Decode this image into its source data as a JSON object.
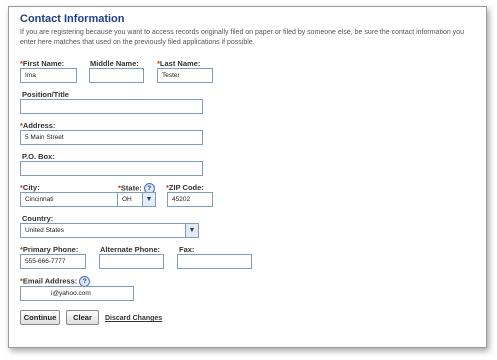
{
  "section": {
    "title": "Contact Information",
    "description": "If you are registering because you want to access records originally filed on paper or filed by someone else, be sure the contact information you enter here matches that used on the previously filed applications if possible."
  },
  "required_marker": "*",
  "help_icon_glyph": "?",
  "fields": {
    "first_name": {
      "label": "First Name:",
      "value": "Ima"
    },
    "middle_name": {
      "label": "Middle Name:",
      "value": ""
    },
    "last_name": {
      "label": "Last Name:",
      "value": "Tester"
    },
    "position_title": {
      "label": "Position/Title",
      "value": ""
    },
    "address": {
      "label": "Address:",
      "value": "5 Main Street"
    },
    "po_box": {
      "label": "P.O. Box:",
      "value": ""
    },
    "city": {
      "label": "City:",
      "value": "Cincinnati"
    },
    "state": {
      "label": "State:",
      "value": "OH"
    },
    "zip": {
      "label": "ZIP Code:",
      "value": "45202"
    },
    "country": {
      "label": "Country:",
      "value": "United States"
    },
    "primary_phone": {
      "label": "Primary Phone:",
      "value": "555-666-7777"
    },
    "alternate_phone": {
      "label": "Alternate Phone:",
      "value": ""
    },
    "fax": {
      "label": "Fax:",
      "value": ""
    },
    "email": {
      "label": "Email Address:",
      "value": "i@yahoo.com"
    }
  },
  "actions": {
    "continue_label": "Continue",
    "clear_label": "Clear",
    "discard_label": "Discard Changes"
  },
  "colors": {
    "title": "#1f3f8a",
    "required": "#cc3300",
    "input_border": "#7f9db9"
  }
}
